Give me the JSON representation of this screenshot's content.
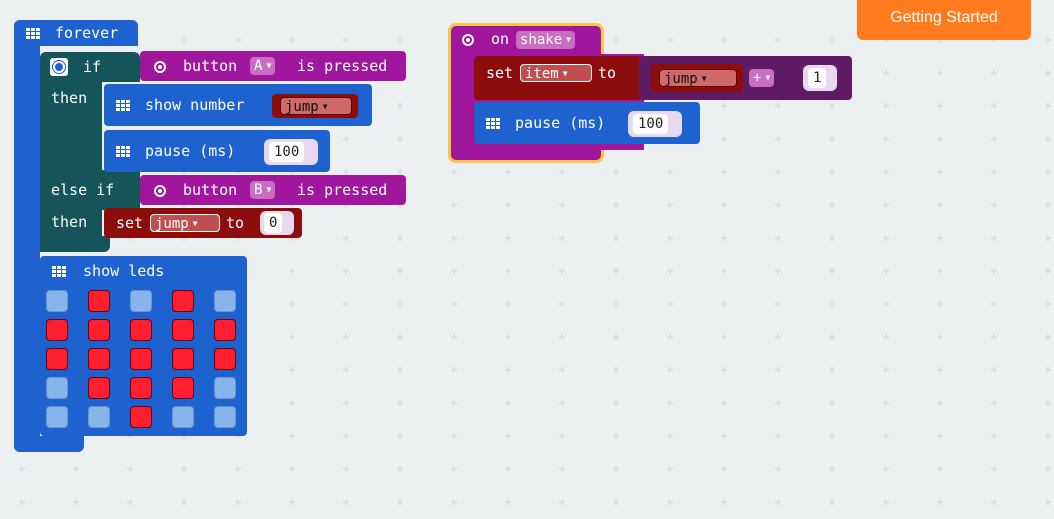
{
  "header": {
    "getting_started": "Getting Started"
  },
  "forever_block": {
    "label": "forever",
    "if_label": "if",
    "then_label": "then",
    "else_if_label": "else if",
    "then2_label": "then",
    "cond1": {
      "prefix": "button",
      "button": "A",
      "suffix": "is pressed"
    },
    "show_number": {
      "label": "show number",
      "var": "jump"
    },
    "pause": {
      "label": "pause (ms)",
      "value": "100"
    },
    "cond2": {
      "prefix": "button",
      "button": "B",
      "suffix": "is pressed"
    },
    "set_block": {
      "set": "set",
      "var": "jump",
      "to": "to",
      "value": "0"
    },
    "show_leds": {
      "label": "show leds",
      "grid": [
        [
          0,
          1,
          0,
          1,
          0
        ],
        [
          1,
          1,
          1,
          1,
          1
        ],
        [
          1,
          1,
          1,
          1,
          1
        ],
        [
          0,
          1,
          1,
          1,
          0
        ],
        [
          0,
          0,
          1,
          0,
          0
        ]
      ]
    }
  },
  "shake_block": {
    "on": "on",
    "event": "shake",
    "set": "set",
    "var": "item",
    "to": "to",
    "expr_var": "jump",
    "operator": "+",
    "operand": "1",
    "pause_label": "pause (ms)",
    "pause_value": "100"
  },
  "colors": {
    "basic": "#1e62d0",
    "logic": "#15555a",
    "input": "#a0169c",
    "variables": "#8d0c0c",
    "math": "#5e1a62",
    "accent": "#ff7b1d",
    "led_on": "#ff1f2f",
    "led_off": "#87b4ea"
  }
}
